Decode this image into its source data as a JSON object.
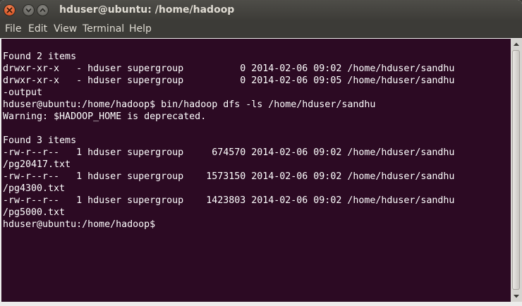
{
  "window": {
    "title": "hduser@ubuntu: /home/hadoop"
  },
  "menubar": {
    "items": [
      "File",
      "Edit",
      "View",
      "Terminal",
      "Help"
    ]
  },
  "terminal": {
    "lines": [
      "Found 2 items",
      "drwxr-xr-x   - hduser supergroup          0 2014-02-06 09:02 /home/hduser/sandhu",
      "drwxr-xr-x   - hduser supergroup          0 2014-02-06 09:05 /home/hduser/sandhu",
      "-output",
      "hduser@ubuntu:/home/hadoop$ bin/hadoop dfs -ls /home/hduser/sandhu",
      "Warning: $HADOOP_HOME is deprecated.",
      "",
      "Found 3 items",
      "-rw-r--r--   1 hduser supergroup     674570 2014-02-06 09:02 /home/hduser/sandhu",
      "/pg20417.txt",
      "-rw-r--r--   1 hduser supergroup    1573150 2014-02-06 09:02 /home/hduser/sandhu",
      "/pg4300.txt",
      "-rw-r--r--   1 hduser supergroup    1423803 2014-02-06 09:02 /home/hduser/sandhu",
      "/pg5000.txt",
      "hduser@ubuntu:/home/hadoop$"
    ]
  },
  "colors": {
    "terminal_background": "#2c0a23",
    "terminal_text": "#ffffff",
    "titlebar": "#3c3b37",
    "close_button": "#e2571f"
  }
}
